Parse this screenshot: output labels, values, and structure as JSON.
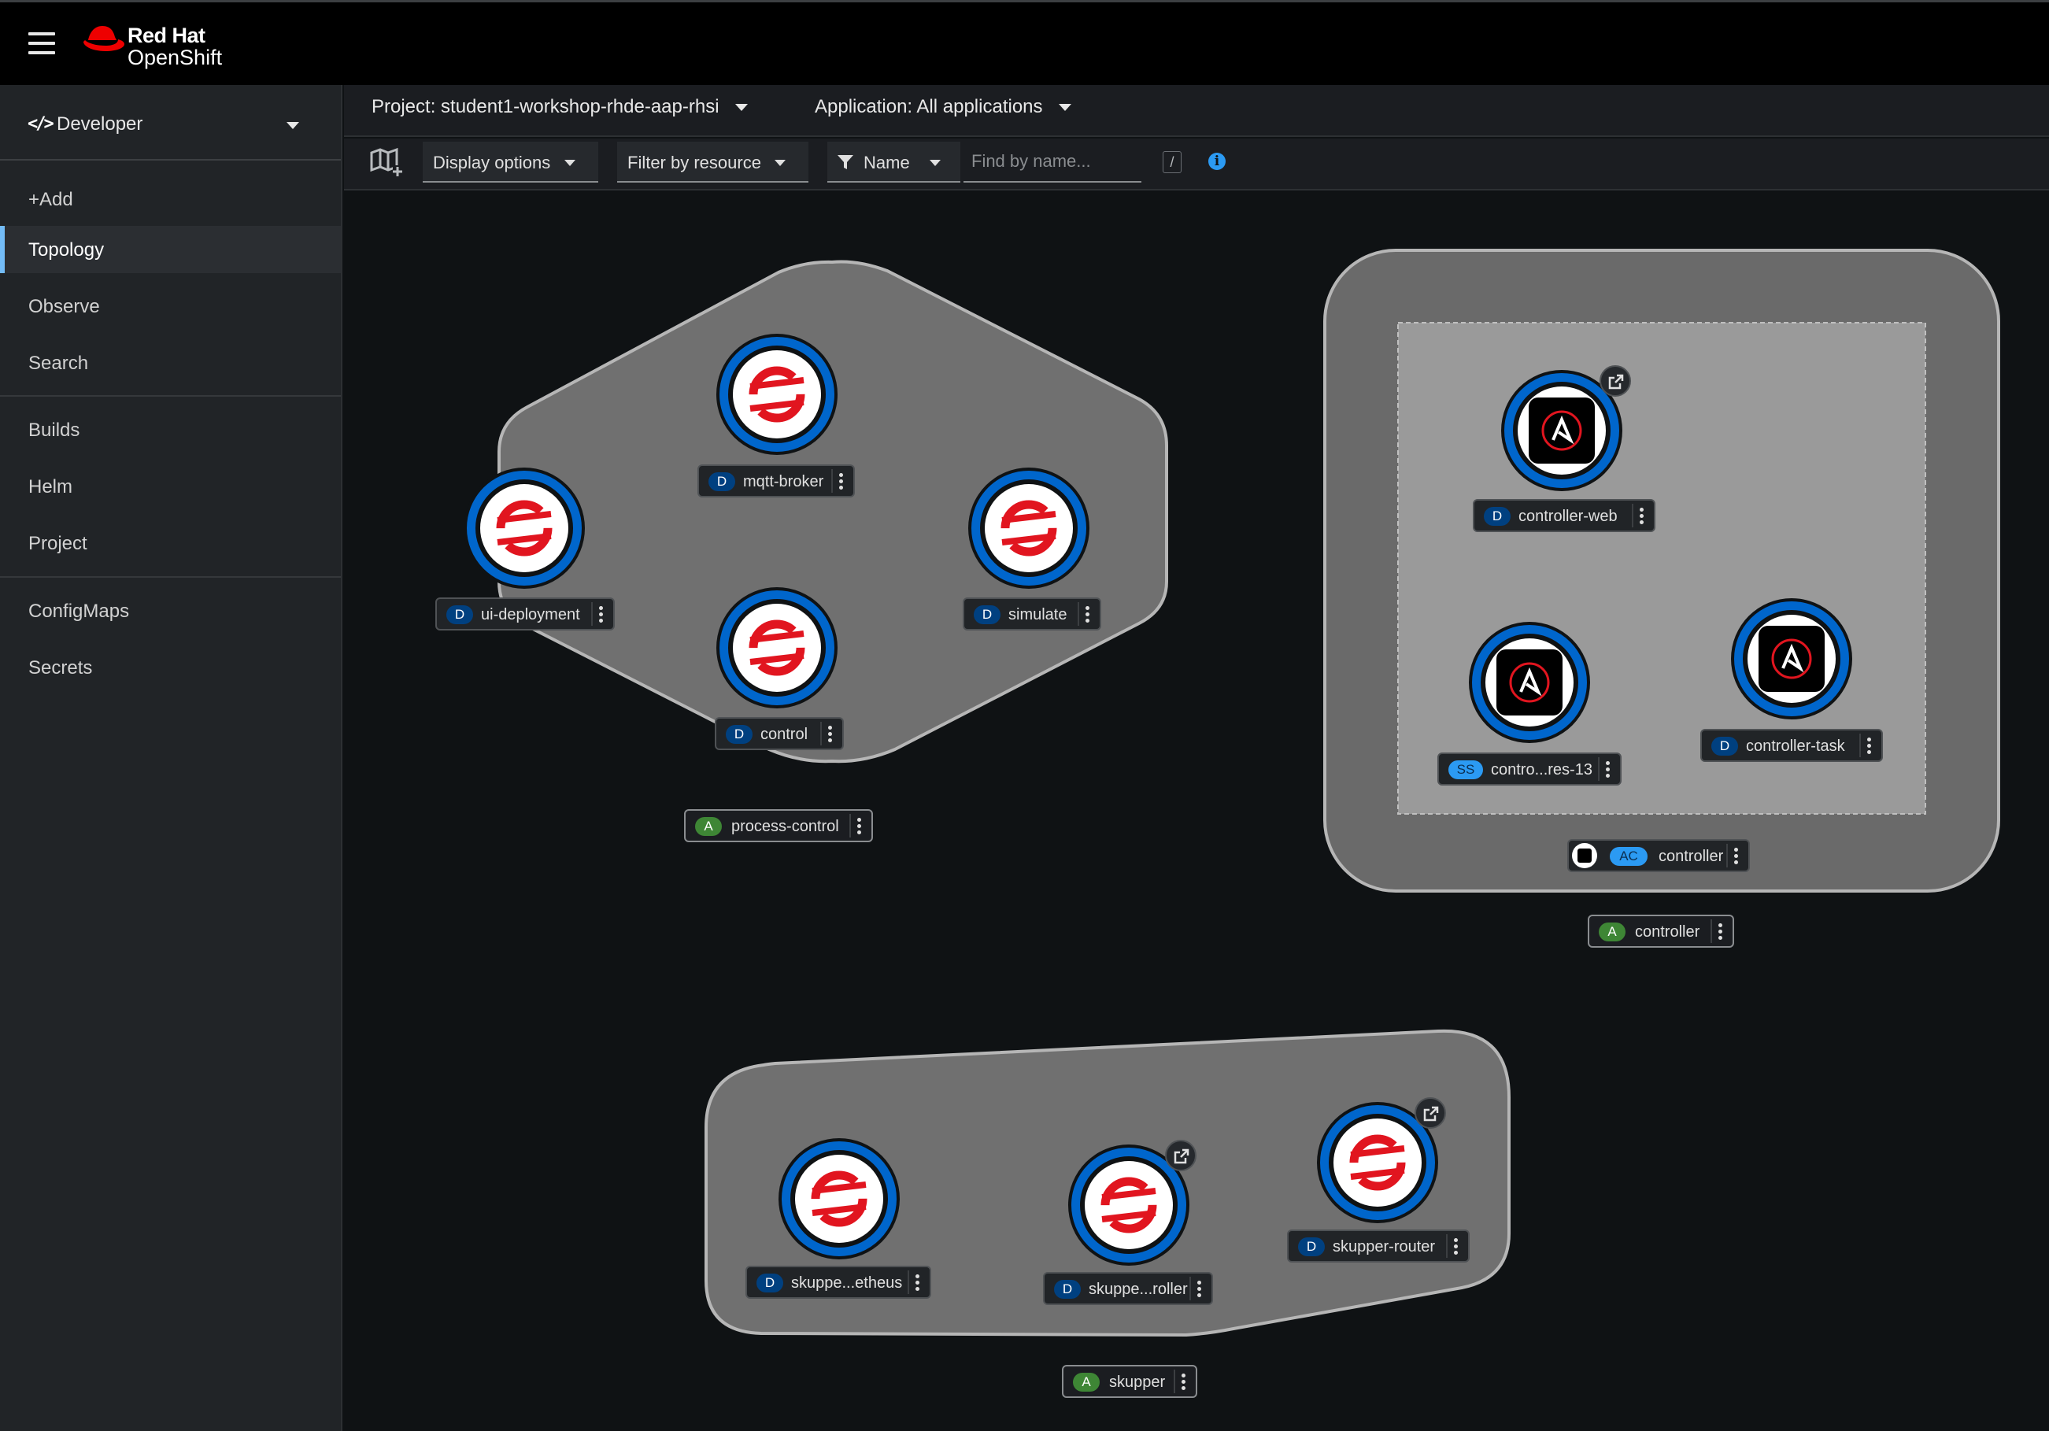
{
  "brand": {
    "line1": "Red Hat",
    "line2": "OpenShift",
    "accent": "#ee0000"
  },
  "perspective": {
    "label": "Developer"
  },
  "nav": {
    "items": [
      {
        "label": "+Add"
      },
      {
        "label": "Topology",
        "active": true
      },
      {
        "label": "Observe"
      },
      {
        "label": "Search"
      },
      {
        "label": "Builds"
      },
      {
        "label": "Helm"
      },
      {
        "label": "Project"
      },
      {
        "label": "ConfigMaps"
      },
      {
        "label": "Secrets"
      }
    ]
  },
  "projbar": {
    "project": "Project: student1-workshop-rhde-aap-rhsi",
    "application": "Application: All applications"
  },
  "toolbar": {
    "display_options": "Display options",
    "filter_by_resource": "Filter by resource",
    "filter_type": "Name",
    "search_placeholder": "Find by name...",
    "search_value": "",
    "shortcut_hint": "/"
  },
  "topology": {
    "groups": [
      {
        "name": "process-control",
        "badge": "A"
      },
      {
        "name": "controller",
        "badge": "A"
      },
      {
        "name": "skupper",
        "badge": "A"
      }
    ],
    "operator_group": {
      "name": "controller",
      "badge": "AC"
    },
    "nodes": [
      {
        "name": "mqtt-broker",
        "badge": "D",
        "icon": "openshift-icon"
      },
      {
        "name": "ui-deployment",
        "badge": "D",
        "icon": "openshift-icon"
      },
      {
        "name": "simulate",
        "badge": "D",
        "icon": "openshift-icon"
      },
      {
        "name": "control",
        "badge": "D",
        "icon": "openshift-icon"
      },
      {
        "name": "controller-web",
        "badge": "D",
        "icon": "ansible-icon",
        "external_link": true
      },
      {
        "name": "contro...res-13",
        "badge": "SS",
        "icon": "ansible-icon"
      },
      {
        "name": "controller-task",
        "badge": "D",
        "icon": "ansible-icon"
      },
      {
        "name": "skuppe...etheus",
        "badge": "D",
        "icon": "openshift-icon"
      },
      {
        "name": "skuppe...roller",
        "badge": "D",
        "icon": "openshift-icon",
        "external_link": true
      },
      {
        "name": "skupper-router",
        "badge": "D",
        "icon": "openshift-icon",
        "external_link": true
      }
    ]
  },
  "colors": {
    "node_ring": "#0066cc",
    "deployment_badge": "#004080",
    "application_badge": "#3e8635",
    "statefulset_badge": "#2b9af3",
    "active_nav": "#73bcf7"
  }
}
